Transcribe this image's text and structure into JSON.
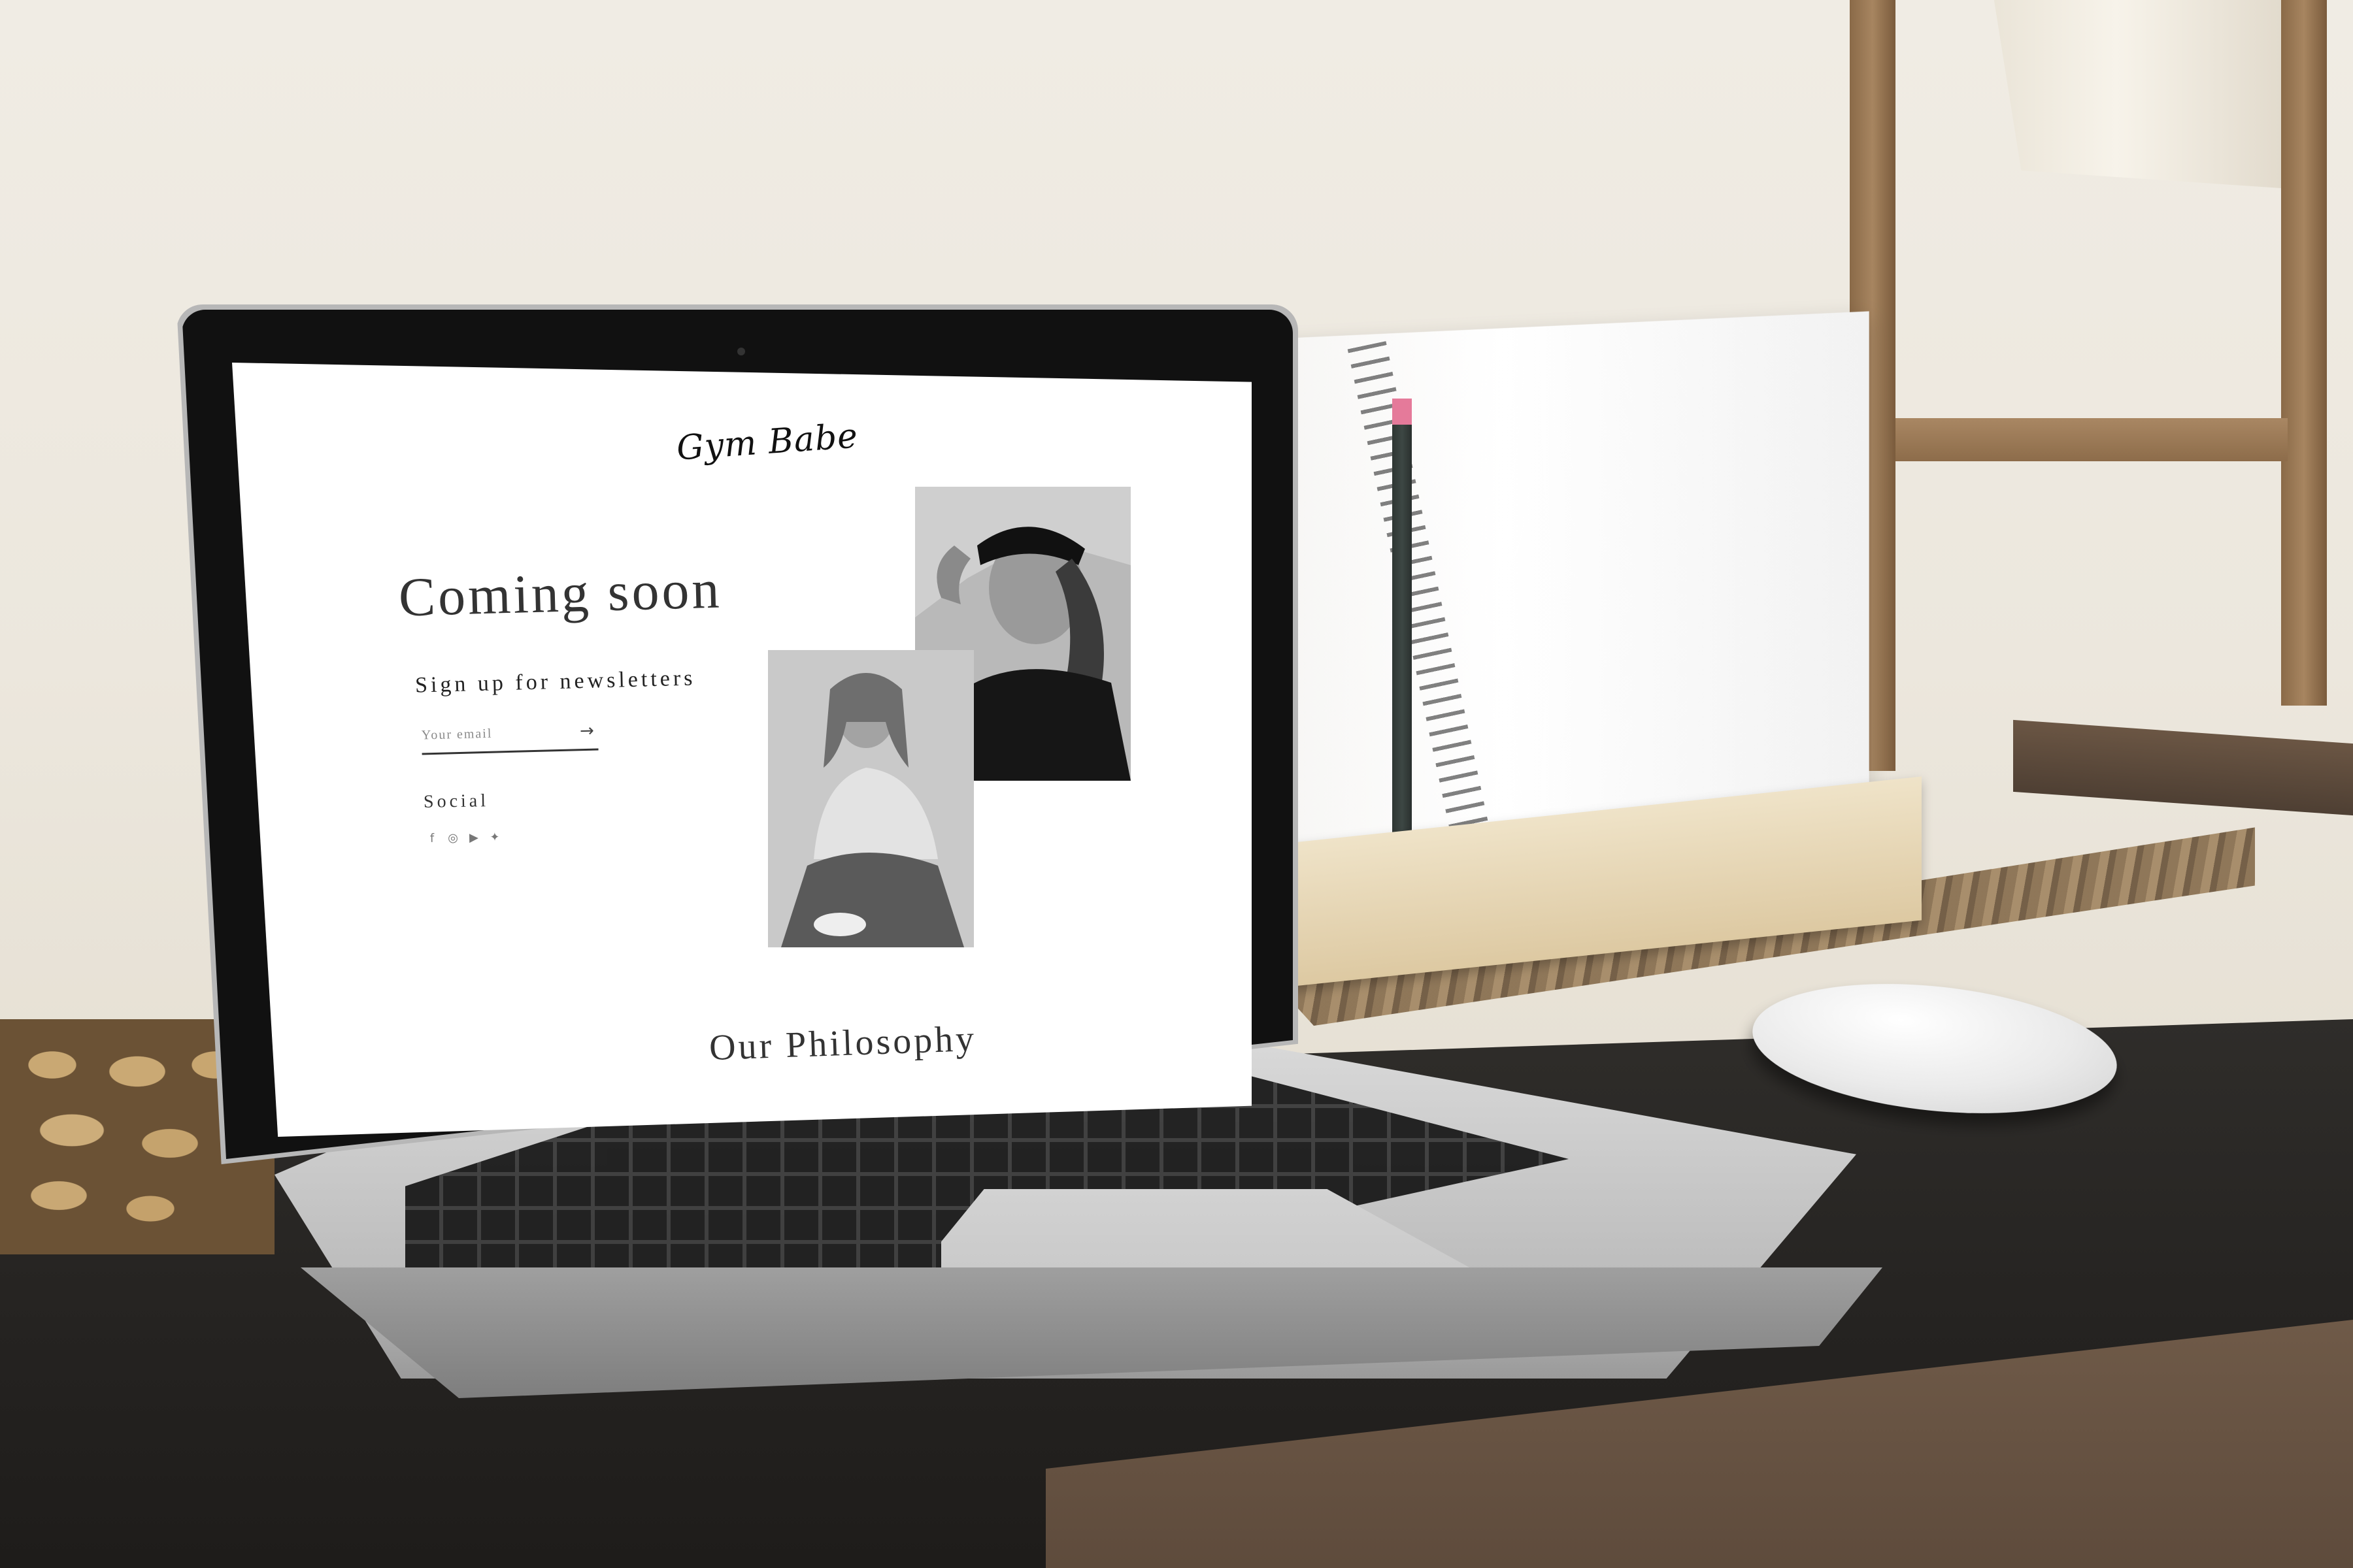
{
  "page": {
    "brand": "Gym Babe",
    "hero_title": "Coming soon",
    "newsletter": {
      "label": "Sign up for newsletters",
      "email_placeholder": "Your email",
      "submit_icon": "arrow-right-icon"
    },
    "social": {
      "label": "Social",
      "icons": [
        "facebook-icon",
        "instagram-icon",
        "youtube-icon",
        "twitter-icon"
      ]
    },
    "photos": [
      {
        "name": "photo-woman-cap",
        "tone": "monochrome"
      },
      {
        "name": "photo-woman-seated",
        "tone": "monochrome"
      }
    ],
    "section_heading": "Our Philosophy"
  },
  "colors": {
    "background": "#ffffff",
    "text": "#333333",
    "accent": "#111111"
  }
}
